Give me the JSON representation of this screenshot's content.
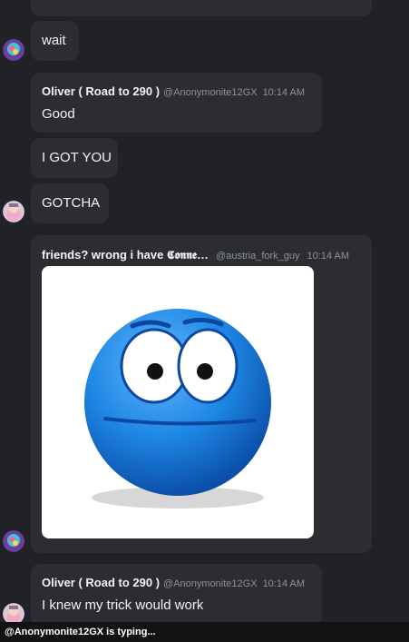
{
  "messages": [
    {
      "text": "wait"
    },
    {
      "author": "Oliver ( Road to 290 )",
      "handle": "@Anonymonite12GX",
      "time": "10:14 AM",
      "text": "Good"
    },
    {
      "text": "I GOT YOU"
    },
    {
      "text": "GOTCHA"
    },
    {
      "author": "friends? wrong i have 𝕮𝖔𝖓𝖓𝖊…",
      "handle": "@austria_fork_guy",
      "time": "10:14 AM",
      "image": "blue-emoji-wide-eyes"
    },
    {
      "author": "Oliver ( Road to 290 )",
      "handle": "@Anonymonite12GX",
      "time": "10:14 AM",
      "text": "I knew my trick would work"
    }
  ],
  "typing_indicator": "@Anonymonite12GX is typing...",
  "colors": {
    "background": "#202225",
    "bubble": "#2b2d31",
    "muted": "#8e9297",
    "emoji_blue": "#1e88e5"
  }
}
